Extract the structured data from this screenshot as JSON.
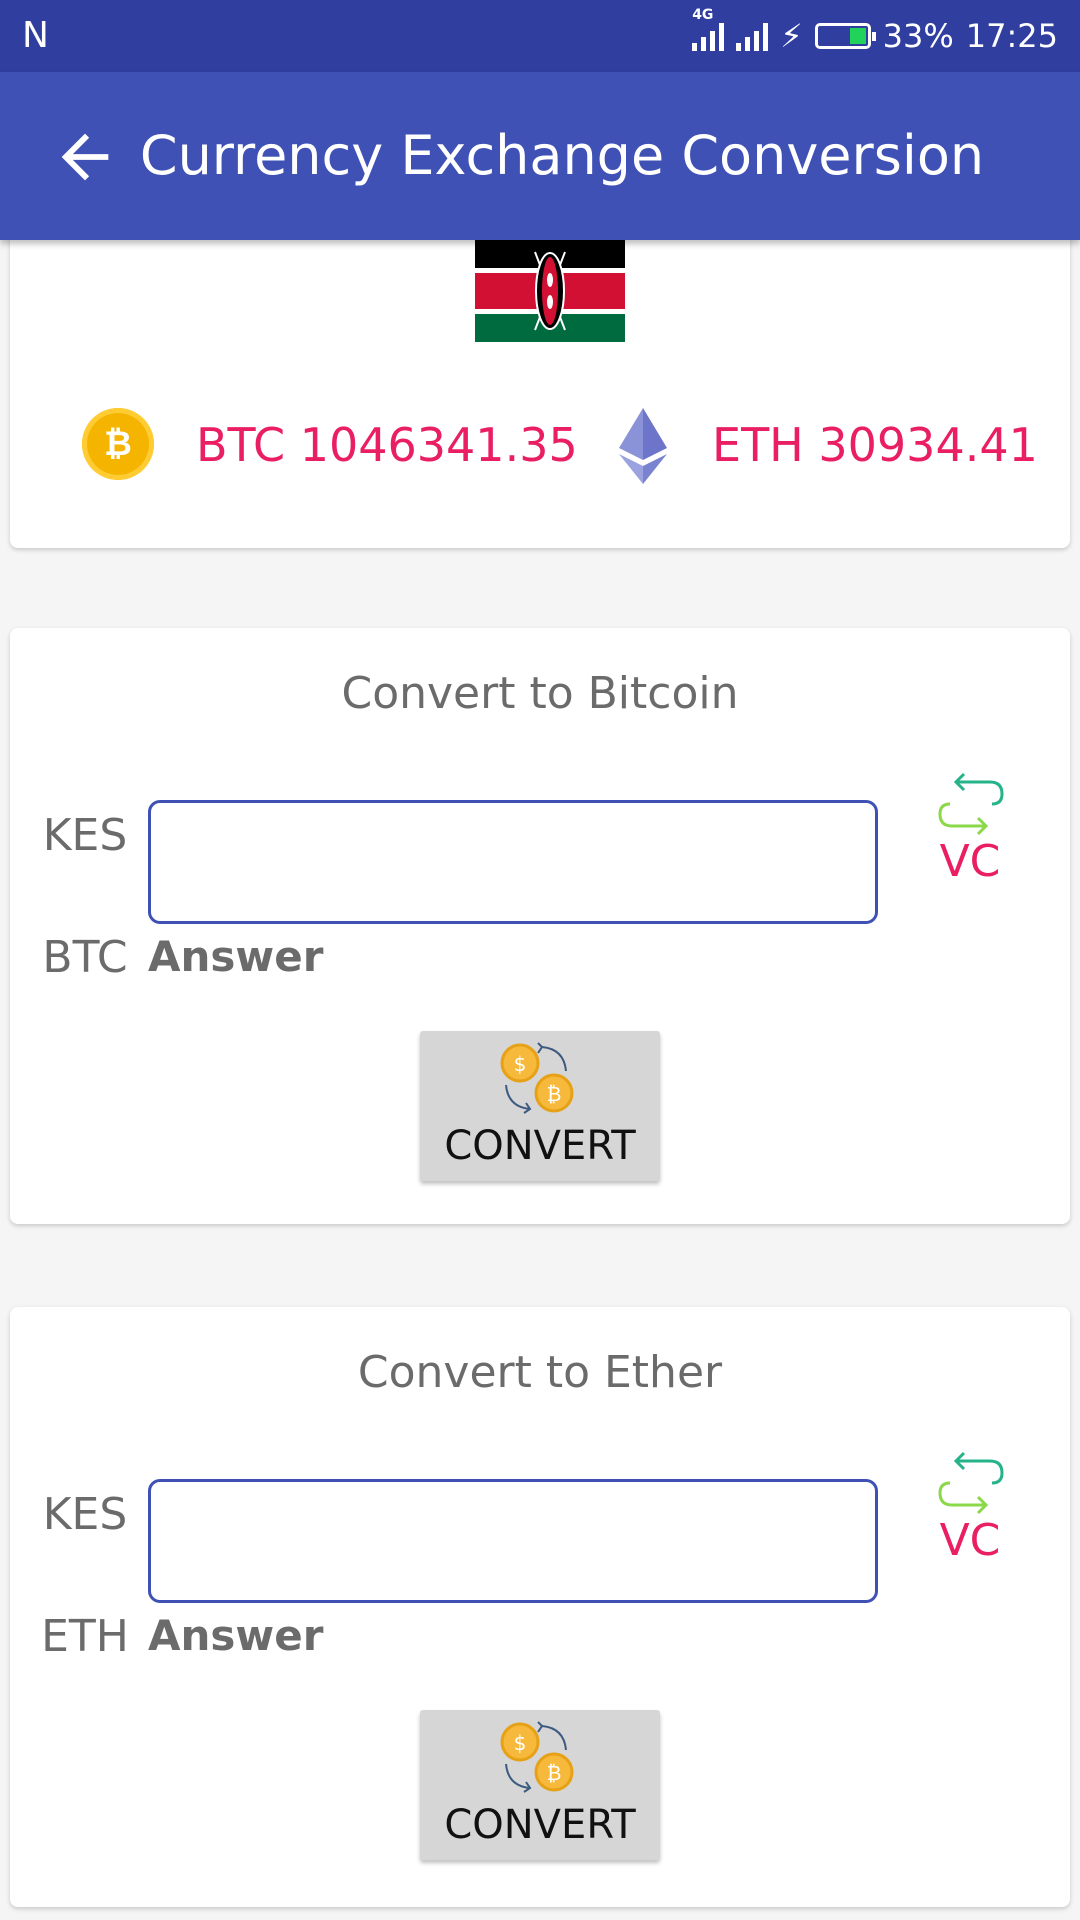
{
  "status_bar": {
    "notification_icon": "N",
    "network": "4G",
    "battery": "33%",
    "time": "17:25"
  },
  "app_bar": {
    "back_icon": "arrow-left-icon",
    "title": "Currency Exchange Conversion"
  },
  "rates_card": {
    "flag": "kenya-flag",
    "btc_rate": "BTC 1046341.35",
    "eth_rate": "ETH 30934.41"
  },
  "btc_card": {
    "title": "Convert to Bitcoin",
    "from_label": "KES",
    "from_value": "",
    "to_label": "BTC",
    "answer": "Answer",
    "swap_label": "VC",
    "button_label": "CONVERT"
  },
  "eth_card": {
    "title": "Convert to Ether",
    "from_label": "KES",
    "from_value": "",
    "to_label": "ETH",
    "answer": "Answer",
    "swap_label": "VC",
    "button_label": "CONVERT"
  },
  "colors": {
    "primary": "#3f51b5",
    "primary_dark": "#303f9f",
    "accent": "#e91e63",
    "text_gray": "#6b6b6b"
  }
}
